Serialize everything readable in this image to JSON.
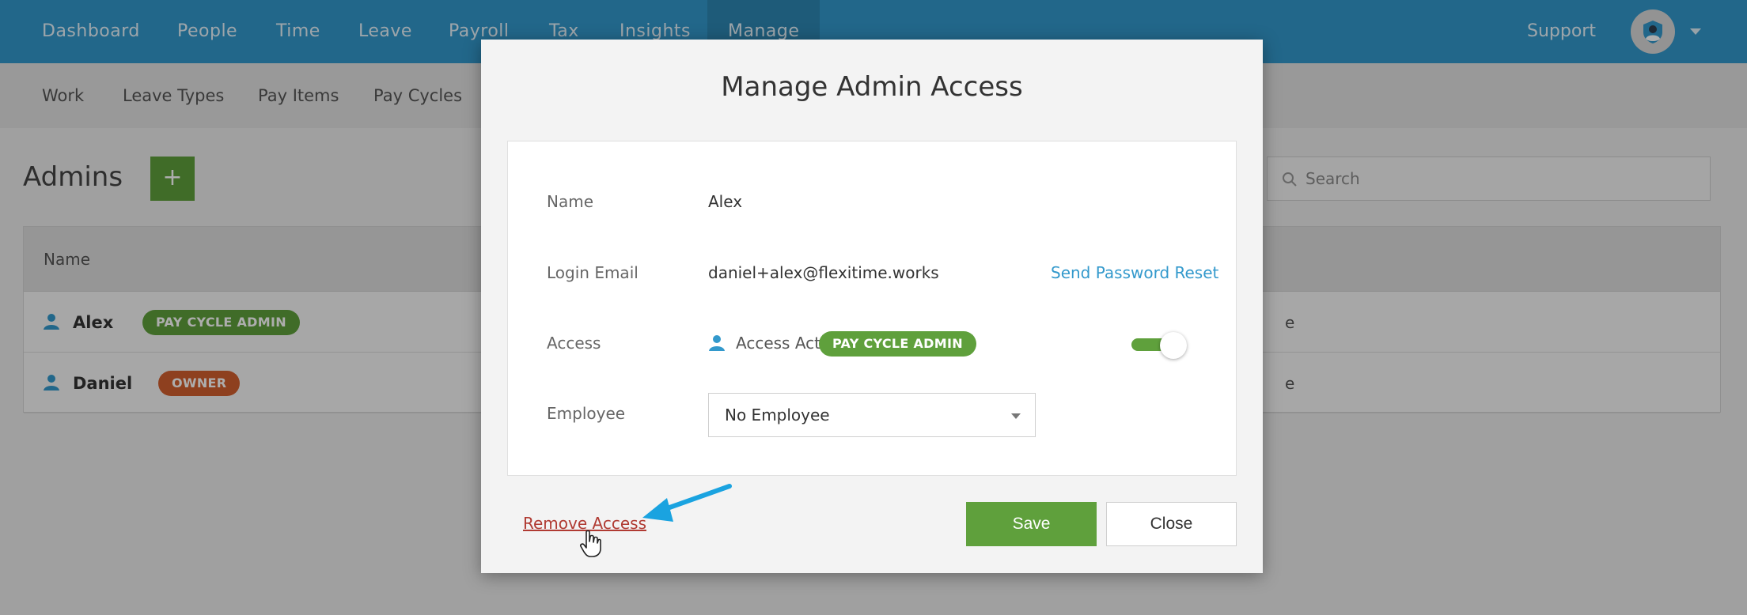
{
  "topnav": {
    "items": [
      "Dashboard",
      "People",
      "Time",
      "Leave",
      "Payroll",
      "Tax",
      "Insights",
      "Manage"
    ],
    "active": "Manage",
    "support": "Support"
  },
  "subnav": {
    "items": [
      "Work",
      "Leave Types",
      "Pay Items",
      "Pay Cycles"
    ]
  },
  "page": {
    "title": "Admins",
    "add_label": "+",
    "search_placeholder": "Search"
  },
  "table": {
    "header_name": "Name",
    "rows": [
      {
        "name": "Alex",
        "badge": "PAY CYCLE ADMIN",
        "tail": "e"
      },
      {
        "name": "Daniel",
        "badge": "OWNER",
        "tail": "e"
      }
    ]
  },
  "modal": {
    "title": "Manage Admin Access",
    "name_label": "Name",
    "name_value": "Alex",
    "email_label": "Login Email",
    "email_value": "daniel+alex@flexitime.works",
    "reset_link": "Send Password Reset",
    "access_label": "Access",
    "access_status": "Access Active",
    "access_badge": "PAY CYCLE ADMIN",
    "toggle_on": true,
    "employee_label": "Employee",
    "employee_value": "No Employee",
    "remove_link": "Remove Access",
    "save_label": "Save",
    "close_label": "Close"
  },
  "colors": {
    "nav_blue": "#3399cc",
    "green": "#5fa03c",
    "orange": "#d25f2e",
    "link_red": "#b03a32",
    "annotation_arrow": "#1aa3e0"
  },
  "icons": [
    "person-icon",
    "search-icon",
    "avatar-icon",
    "chevron-down-icon",
    "hand-cursor-icon",
    "annotation-arrow"
  ]
}
